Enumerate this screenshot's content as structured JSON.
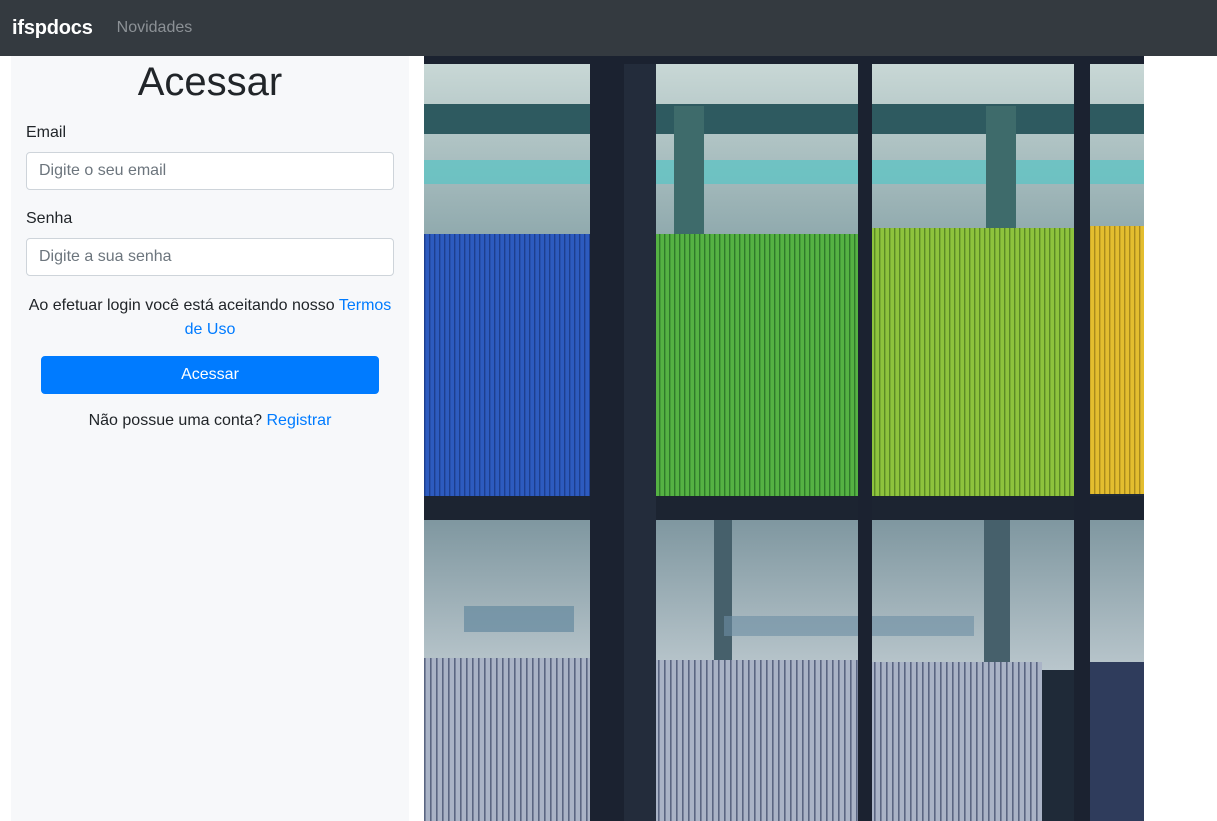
{
  "navbar": {
    "brand": "ifspdocs",
    "links": [
      {
        "label": "Novidades"
      }
    ]
  },
  "login": {
    "title": "Acessar",
    "email_label": "Email",
    "email_placeholder": "Digite o seu email",
    "password_label": "Senha",
    "password_placeholder": "Digite a sua senha",
    "terms_text": "Ao efetuar login você está aceitando nosso ",
    "terms_link": "Termos de Uso",
    "submit_label": "Acessar",
    "register_text": "Não possue uma conta? ",
    "register_link": "Registrar"
  },
  "colors": {
    "navbar_bg": "#343a40",
    "primary": "#007bff",
    "panel_bg": "#f7f8fa"
  }
}
